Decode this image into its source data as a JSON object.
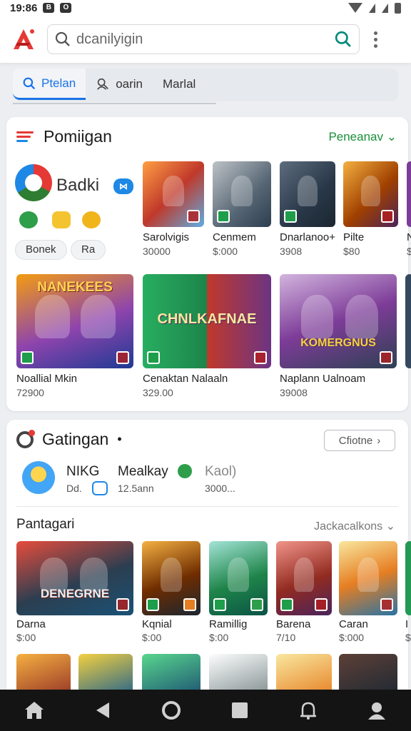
{
  "status_bar": {
    "time": "19:86",
    "icon_b": "B",
    "icon_o": "O"
  },
  "search": {
    "text": "dcanilyigin"
  },
  "tabs": [
    {
      "label": "Ptelan",
      "icon": "search-icon",
      "active": true
    },
    {
      "label": "oarin",
      "icon": "person-icon",
      "active": false
    },
    {
      "label": "Marlal",
      "icon": "",
      "active": false
    }
  ],
  "section1": {
    "title": "Pomiigan",
    "link": "Peneanav",
    "app": {
      "name": "Badki",
      "chips": [
        "Bonek",
        "Ra"
      ]
    },
    "games_row1": [
      {
        "name": "Sarolvigis",
        "price": "30000"
      },
      {
        "name": "Cenmem",
        "price": "$:000"
      },
      {
        "name": "Dnarlanoo+",
        "price": "3908"
      },
      {
        "name": "Pilte",
        "price": "$80"
      },
      {
        "name": "N",
        "price": "$"
      }
    ],
    "features": [
      {
        "name": "Noallial Mkin",
        "price": "72900",
        "art_text": "NANEKEES"
      },
      {
        "name": "Cenaktan Nalaaln",
        "price": "329.00",
        "art_text": "CHNLKAFNAE"
      },
      {
        "name": "Naplann Ualnoam",
        "price": "39008",
        "art_text": "KOMERGNUS"
      }
    ]
  },
  "section2": {
    "title": "Gatingan",
    "more_button": "Cfiotne",
    "user": {
      "name": "NIKG",
      "meta": "Dd.",
      "title": "Mealkay",
      "title_sub": "12.5ann",
      "value": "Kaol)",
      "value_sub": "3000..."
    },
    "subsection_title": "Pantagari",
    "dropdown": "Jackacalkons",
    "games_row": [
      {
        "name": "Darna",
        "price": "$:00",
        "art_text": "DENEGRNE"
      },
      {
        "name": "Kqnial",
        "price": "$:00"
      },
      {
        "name": "Ramillig",
        "price": "$:00"
      },
      {
        "name": "Barena",
        "price": "7/10"
      },
      {
        "name": "Caran",
        "price": "$:000"
      },
      {
        "name": "I",
        "price": "$"
      }
    ]
  },
  "colors": {
    "accent_blue": "#1a73e8",
    "accent_green": "#1a8f3a",
    "nav_bg": "#141414"
  }
}
